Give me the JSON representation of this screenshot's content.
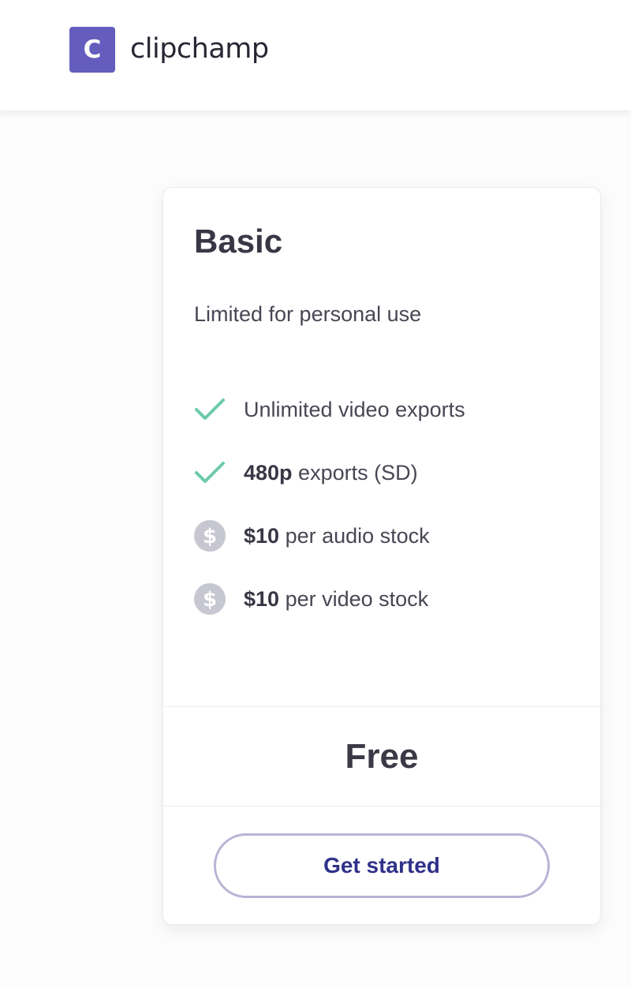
{
  "header": {
    "logo_letter": "C",
    "brand_name": "clipchamp",
    "brand_color": "#645dbd"
  },
  "plan": {
    "name": "Basic",
    "description": "Limited for personal use",
    "features": [
      {
        "icon": "check-icon",
        "bold": "",
        "text": "Unlimited video exports"
      },
      {
        "icon": "check-icon",
        "bold": "480p",
        "text": " exports (SD)"
      },
      {
        "icon": "dollar-coin-icon",
        "bold": "$10",
        "text": " per audio stock"
      },
      {
        "icon": "dollar-coin-icon",
        "bold": "$10",
        "text": " per video stock"
      }
    ],
    "price": "Free",
    "cta_label": "Get started"
  },
  "colors": {
    "check": "#6ccba8",
    "coin": "#c7c7d1",
    "cta_text": "#2f3189",
    "cta_border": "#b6b5d6"
  }
}
